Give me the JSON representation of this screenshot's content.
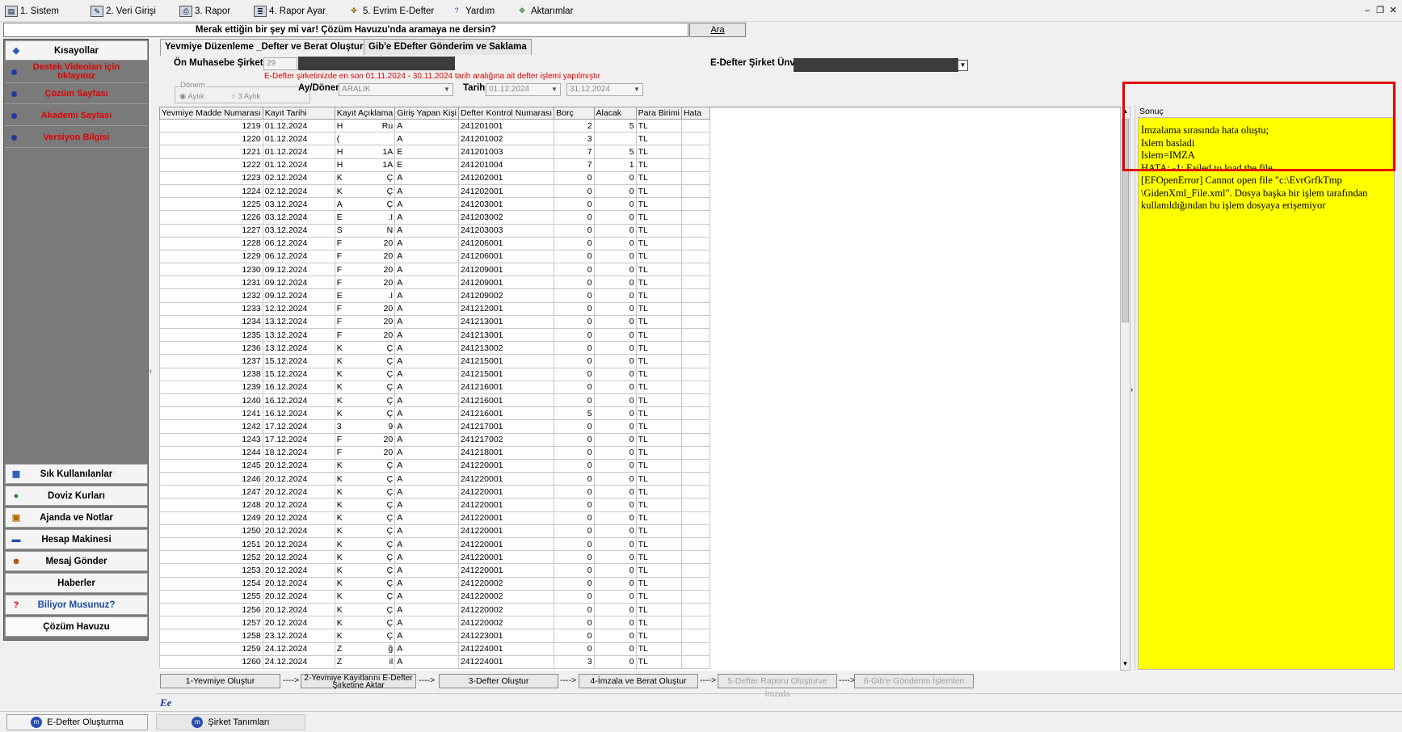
{
  "menu": [
    {
      "label": "1. Sistem",
      "icon": "system-icon"
    },
    {
      "label": "2.   Veri Girişi",
      "icon": "data-entry-icon"
    },
    {
      "label": "3.   Rapor",
      "icon": "printer-icon"
    },
    {
      "label": "4.   Rapor Ayar",
      "icon": "report-settings-icon"
    },
    {
      "label": "5. Evrim E-Defter",
      "icon": "edefter-icon"
    },
    {
      "label": "Yardım",
      "icon": "help-icon"
    },
    {
      "label": "Aktarımlar",
      "icon": "transfer-icon"
    }
  ],
  "search": {
    "text": "Merak ettiğin bir şey mi var! Çözüm Havuzu'nda aramaya ne dersin?",
    "button": "Ara"
  },
  "sidebar": {
    "title": "Kısayollar",
    "links": [
      {
        "label": "Destek Videoları için tıklayınız"
      },
      {
        "label": "Çözüm Sayfası"
      },
      {
        "label": "Akademi Sayfası"
      },
      {
        "label": "Versiyon Bilgisi"
      }
    ],
    "buttons": [
      {
        "label": "Sık Kullanılanlar",
        "icon": "favorites-icon"
      },
      {
        "label": "Doviz Kurları",
        "icon": "currency-icon"
      },
      {
        "label": "Ajanda ve Notlar",
        "icon": "agenda-icon"
      },
      {
        "label": "Hesap Makinesi",
        "icon": "calculator-icon"
      },
      {
        "label": "Mesaj Gönder",
        "icon": "message-icon"
      },
      {
        "label": "Haberler",
        "icon": ""
      },
      {
        "label": "Biliyor Musunuz?",
        "icon": "question-icon"
      },
      {
        "label": "Çözüm Havuzu",
        "icon": ""
      }
    ]
  },
  "tabs": [
    {
      "label": "Yevmiye Düzenleme _Defter ve Berat Oluşturma",
      "active": true
    },
    {
      "label": "Gib'e EDefter Gönderim ve Saklama",
      "active": false
    }
  ],
  "form": {
    "company_label": "Ön Muhasebe Şirket N",
    "company_no": "29",
    "edefter_label": "E-Defter Şirket Ünva",
    "warning": "E-Defter şirketinizde en son 01.11.2024 - 30.11.2024 tarih aralığına ait defter işlemi yapılmıştır",
    "donem_label": "Dönem",
    "radio_aylik": "Aylık",
    "radio_3aylik": "3 Aylık",
    "ay_donem_label": "Ay/Dönem",
    "ay_donem_value": "ARALIK",
    "tarih_label": "Tarih",
    "tarih_start": "01.12.2024",
    "tarih_end": "31.12.2024"
  },
  "grid": {
    "columns": [
      "Yevmiye Madde Numarası",
      "Kayıt Tarihi",
      "Kayıt Açıklama",
      "Giriş Yapan Kişi",
      "Defter Kontrol Numarası",
      "Borç",
      "Alacak",
      "Para Birimi",
      "Hata"
    ],
    "rows": [
      [
        "1219",
        "01.12.2024",
        "H",
        "Ru",
        "A",
        "241201001",
        "2",
        "5",
        "TL"
      ],
      [
        "1220",
        "01.12.2024",
        "(",
        "",
        "A",
        "241201002",
        "3",
        "",
        "TL"
      ],
      [
        "1221",
        "01.12.2024",
        "H",
        "1A",
        "E",
        "241201003",
        "7",
        "5",
        "TL"
      ],
      [
        "1222",
        "01.12.2024",
        "H",
        "1A",
        "E",
        "241201004",
        "7",
        "1",
        "TL"
      ],
      [
        "1223",
        "02.12.2024",
        "K",
        "Ç",
        "A",
        "241202001",
        "0",
        "0",
        "TL"
      ],
      [
        "1224",
        "02.12.2024",
        "K",
        "Ç",
        "A",
        "241202001",
        "0",
        "0",
        "TL"
      ],
      [
        "1225",
        "03.12.2024",
        "A",
        "Ç",
        "A",
        "241203001",
        "0",
        "0",
        "TL"
      ],
      [
        "1226",
        "03.12.2024",
        "E",
        ".I",
        "A",
        "241203002",
        "0",
        "0",
        "TL"
      ],
      [
        "1227",
        "03.12.2024",
        "S",
        "N",
        "A",
        "241203003",
        "0",
        "0",
        "TL"
      ],
      [
        "1228",
        "06.12.2024",
        "F",
        "20",
        "A",
        "241206001",
        "0",
        "0",
        "TL"
      ],
      [
        "1229",
        "06.12.2024",
        "F",
        "20",
        "A",
        "241206001",
        "0",
        "0",
        "TL"
      ],
      [
        "1230",
        "09.12.2024",
        "F",
        "20",
        "A",
        "241209001",
        "0",
        "0",
        "TL"
      ],
      [
        "1231",
        "09.12.2024",
        "F",
        "20",
        "A",
        "241209001",
        "0",
        "0",
        "TL"
      ],
      [
        "1232",
        "09.12.2024",
        "E",
        ".I",
        "A",
        "241209002",
        "0",
        "0",
        "TL"
      ],
      [
        "1233",
        "12.12.2024",
        "F",
        "20",
        "A",
        "241212001",
        "0",
        "0",
        "TL"
      ],
      [
        "1234",
        "13.12.2024",
        "F",
        "20",
        "A",
        "241213001",
        "0",
        "0",
        "TL"
      ],
      [
        "1235",
        "13.12.2024",
        "F",
        "20",
        "A",
        "241213001",
        "0",
        "0",
        "TL"
      ],
      [
        "1236",
        "13.12.2024",
        "K",
        "Ç",
        "A",
        "241213002",
        "0",
        "0",
        "TL"
      ],
      [
        "1237",
        "15.12.2024",
        "K",
        "Ç",
        "A",
        "241215001",
        "0",
        "0",
        "TL"
      ],
      [
        "1238",
        "15.12.2024",
        "K",
        "Ç",
        "A",
        "241215001",
        "0",
        "0",
        "TL"
      ],
      [
        "1239",
        "16.12.2024",
        "K",
        "Ç",
        "A",
        "241216001",
        "0",
        "0",
        "TL"
      ],
      [
        "1240",
        "16.12.2024",
        "K",
        "Ç",
        "A",
        "241216001",
        "0",
        "0",
        "TL"
      ],
      [
        "1241",
        "16.12.2024",
        "K",
        "Ç",
        "A",
        "241216001",
        "5",
        "0",
        "TL"
      ],
      [
        "1242",
        "17.12.2024",
        "3",
        "9",
        "A",
        "241217001",
        "0",
        "0",
        "TL"
      ],
      [
        "1243",
        "17.12.2024",
        "F",
        "20",
        "A",
        "241217002",
        "0",
        "0",
        "TL"
      ],
      [
        "1244",
        "18.12.2024",
        "F",
        "20",
        "A",
        "241218001",
        "0",
        "0",
        "TL"
      ],
      [
        "1245",
        "20.12.2024",
        "K",
        "Ç",
        "A",
        "241220001",
        "0",
        "0",
        "TL"
      ],
      [
        "1246",
        "20.12.2024",
        "K",
        "Ç",
        "A",
        "241220001",
        "0",
        "0",
        "TL"
      ],
      [
        "1247",
        "20.12.2024",
        "K",
        "Ç",
        "A",
        "241220001",
        "0",
        "0",
        "TL"
      ],
      [
        "1248",
        "20.12.2024",
        "K",
        "Ç",
        "A",
        "241220001",
        "0",
        "0",
        "TL"
      ],
      [
        "1249",
        "20.12.2024",
        "K",
        "Ç",
        "A",
        "241220001",
        "0",
        "0",
        "TL"
      ],
      [
        "1250",
        "20.12.2024",
        "K",
        "Ç",
        "A",
        "241220001",
        "0",
        "0",
        "TL"
      ],
      [
        "1251",
        "20.12.2024",
        "K",
        "Ç",
        "A",
        "241220001",
        "0",
        "0",
        "TL"
      ],
      [
        "1252",
        "20.12.2024",
        "K",
        "Ç",
        "A",
        "241220001",
        "0",
        "0",
        "TL"
      ],
      [
        "1253",
        "20.12.2024",
        "K",
        "Ç",
        "A",
        "241220001",
        "0",
        "0",
        "TL"
      ],
      [
        "1254",
        "20.12.2024",
        "K",
        "Ç",
        "A",
        "241220002",
        "0",
        "0",
        "TL"
      ],
      [
        "1255",
        "20.12.2024",
        "K",
        "Ç",
        "A",
        "241220002",
        "0",
        "0",
        "TL"
      ],
      [
        "1256",
        "20.12.2024",
        "K",
        "Ç",
        "A",
        "241220002",
        "0",
        "0",
        "TL"
      ],
      [
        "1257",
        "20.12.2024",
        "K",
        "Ç",
        "A",
        "241220002",
        "0",
        "0",
        "TL"
      ],
      [
        "1258",
        "23.12.2024",
        "K",
        "Ç",
        "A",
        "241223001",
        "0",
        "0",
        "TL"
      ],
      [
        "1259",
        "24.12.2024",
        "Z",
        "ğ",
        "A",
        "241224001",
        "0",
        "0",
        "TL"
      ],
      [
        "1260",
        "24.12.2024",
        "Z",
        "il",
        "A",
        "241224001",
        "3",
        "0",
        "TL"
      ]
    ]
  },
  "result": {
    "title": "Sonuç",
    "lines": [
      "İmzalama sırasında hata oluştu;",
      "Islem basladi",
      "Islem=IMZA",
      "HATA: -1: Failed to load the file",
      "[EFOpenError] Cannot open file \"c:\\EvrGrfkTmp \\GidenXml_File.xml\". Dosya başka bir işlem tarafından kullanıldığından bu işlem dosyaya erişemiyor"
    ]
  },
  "steps": [
    {
      "label": "1-Yevmiye Oluştur",
      "enabled": true
    },
    {
      "label": "2-Yevmiye Kayıtlarını E-Defter Şirketine Aktar",
      "enabled": true
    },
    {
      "label": "3-Defter Oluştur",
      "enabled": true
    },
    {
      "label": "4-İmzala ve Berat Oluştur",
      "enabled": true
    },
    {
      "label": "5-Defter Raporu Oluşturve İmzala",
      "enabled": false
    },
    {
      "label": "6-Gib'e Gönderim İşlemleri",
      "enabled": false
    }
  ],
  "step_arrow": "---->",
  "bottom_tabs": [
    {
      "label": "E-Defter Oluşturma"
    },
    {
      "label": "Şirket Tanımları"
    }
  ],
  "colors": {
    "highlight": "#e60000",
    "result_bg": "#ffff00",
    "link_red": "#e00000"
  }
}
